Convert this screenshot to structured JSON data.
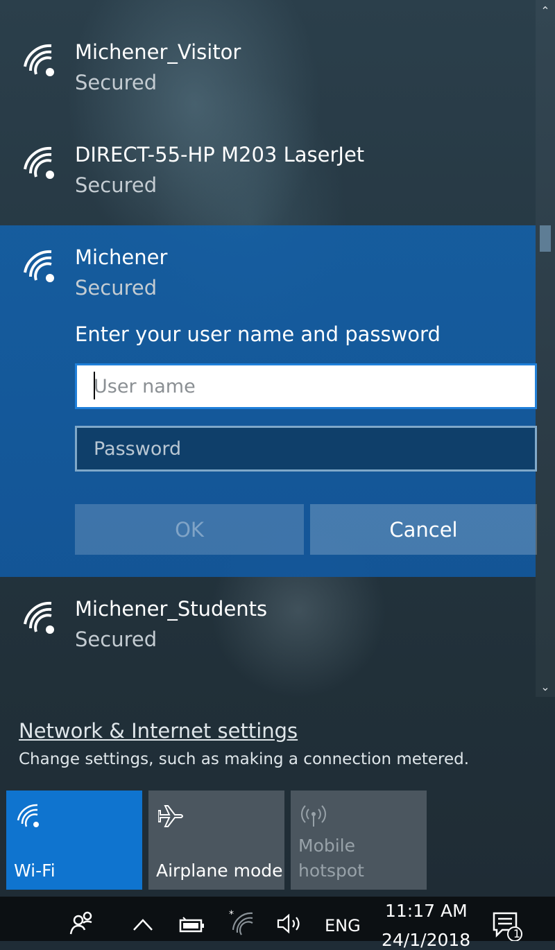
{
  "networks": {
    "visitor": {
      "name": "Michener_Visitor",
      "status": "Secured"
    },
    "direct": {
      "name": "DIRECT-55-HP M203 LaserJet",
      "status": "Secured"
    },
    "michener": {
      "name": "Michener",
      "status": "Secured",
      "prompt": "Enter your user name and password",
      "username_placeholder": "User name",
      "password_placeholder": "Password",
      "ok_label": "OK",
      "cancel_label": "Cancel"
    },
    "students": {
      "name": "Michener_Students",
      "status": "Secured"
    }
  },
  "settings": {
    "link_label": "Network & Internet settings",
    "description": "Change settings, such as making a connection metered."
  },
  "quick_actions": {
    "wifi": {
      "label": "Wi-Fi",
      "active": true
    },
    "airplane": {
      "label": "Airplane mode",
      "active": false
    },
    "hotspot": {
      "label_line1": "Mobile",
      "label_line2": "hotspot",
      "disabled": true
    }
  },
  "taskbar": {
    "language": "ENG",
    "time": "11:17 AM",
    "date": "24/1/2018",
    "notification_count": "1"
  },
  "colors": {
    "selected_network_bg": "#145fa5",
    "wifi_tile_active": "#0f74cf",
    "tile_inactive": "#4b565f"
  }
}
